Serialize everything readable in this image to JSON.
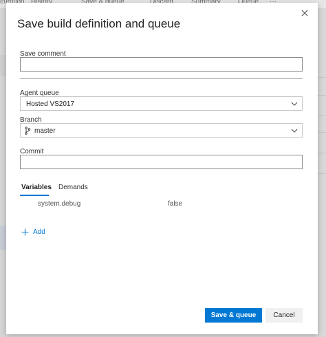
{
  "background": {
    "toolbar_items": [
      "etention",
      "History",
      "Save & queue",
      "Discard",
      "Summary",
      "Queue",
      "···"
    ]
  },
  "dialog": {
    "title": "Save build definition and queue",
    "save_comment": {
      "label": "Save comment",
      "value": ""
    },
    "agent_queue": {
      "label": "Agent queue",
      "value": "Hosted VS2017"
    },
    "branch": {
      "label": "Branch",
      "value": "master"
    },
    "commit": {
      "label": "Commit",
      "value": ""
    },
    "tabs": [
      {
        "label": "Variables",
        "active": true
      },
      {
        "label": "Demands",
        "active": false
      }
    ],
    "variables": [
      {
        "name": "system.debug",
        "value": "false"
      }
    ],
    "add_label": "Add",
    "buttons": {
      "primary": "Save & queue",
      "cancel": "Cancel"
    }
  },
  "colors": {
    "accent": "#0078d4"
  }
}
